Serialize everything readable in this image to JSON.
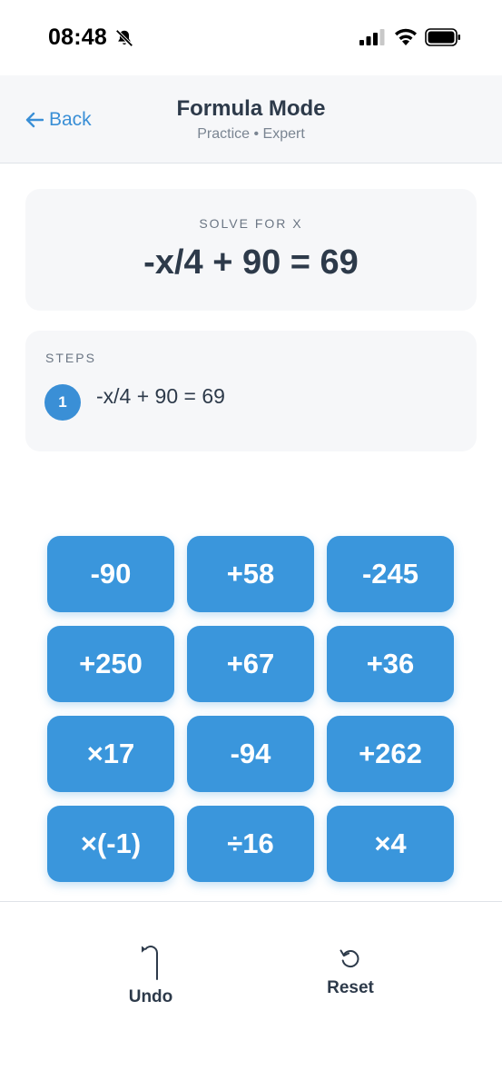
{
  "status_bar": {
    "time": "08:48",
    "icons": [
      "bell-slash-icon",
      "signal-icon",
      "wifi-icon",
      "battery-icon"
    ]
  },
  "nav": {
    "back_label": "Back",
    "title": "Formula Mode",
    "subtitle": "Practice • Expert"
  },
  "problem": {
    "label": "SOLVE FOR X",
    "equation": "-x/4 + 90 = 69"
  },
  "steps": {
    "label": "STEPS",
    "items": [
      {
        "number": "1",
        "text": "-x/4 + 90 = 69"
      }
    ]
  },
  "keypad": {
    "keys": [
      "-90",
      "+58",
      "-245",
      "+250",
      "+67",
      "+36",
      "×17",
      "-94",
      "+262",
      "×(-1)",
      "÷16",
      "×4"
    ]
  },
  "toolbar": {
    "undo_label": "Undo",
    "reset_label": "Reset"
  },
  "colors": {
    "accent": "#3a96dc",
    "text": "#2d3a4a",
    "muted": "#7a8592",
    "card": "#f6f7f9"
  }
}
